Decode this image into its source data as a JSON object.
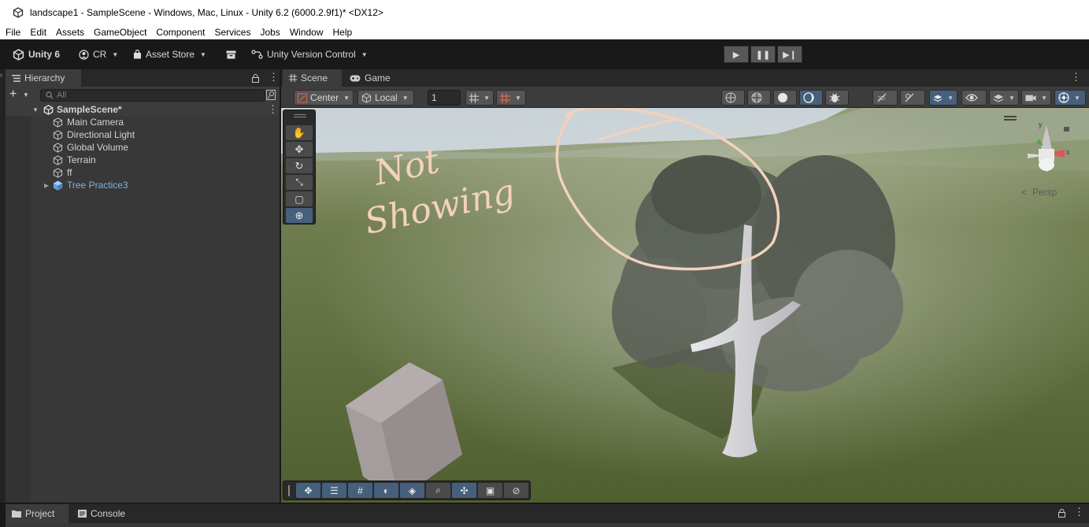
{
  "window": {
    "title": "landscape1 - SampleScene - Windows, Mac, Linux - Unity 6.2 (6000.2.9f1)* <DX12>"
  },
  "menu": [
    "File",
    "Edit",
    "Assets",
    "GameObject",
    "Component",
    "Services",
    "Jobs",
    "Window",
    "Help"
  ],
  "toolbar": {
    "unity_label": "Unity 6",
    "account_label": "CR",
    "asset_store_label": "Asset Store",
    "version_control_label": "Unity Version Control"
  },
  "hierarchy": {
    "tab_label": "Hierarchy",
    "search_placeholder": "All",
    "scene_name": "SampleScene*",
    "items": [
      {
        "label": "Main Camera",
        "icon": "cube-icon"
      },
      {
        "label": "Directional Light",
        "icon": "cube-icon"
      },
      {
        "label": "Global Volume",
        "icon": "cube-icon"
      },
      {
        "label": "Terrain",
        "icon": "cube-icon"
      },
      {
        "label": "ff",
        "icon": "cube-icon"
      },
      {
        "label": "Tree Practice3",
        "icon": "prefab-icon",
        "color": "#7cb3e8",
        "expandable": true
      }
    ]
  },
  "scene": {
    "tabs": [
      {
        "label": "Scene",
        "icon": "grid-icon"
      },
      {
        "label": "Game",
        "icon": "gamepad-icon"
      }
    ],
    "pivot_label": "Center",
    "space_label": "Local",
    "grid_size_value": "1",
    "gizmo_persp_label": "Persp",
    "annotation_text": [
      "Not",
      "Showing"
    ]
  },
  "bottom": {
    "tabs": [
      {
        "label": "Project",
        "icon": "folder-icon"
      },
      {
        "label": "Console",
        "icon": "console-icon"
      }
    ]
  },
  "colors": {
    "accent": "#46607c",
    "prefab": "#7cb3e8",
    "annotation": "#f2d2bd"
  }
}
